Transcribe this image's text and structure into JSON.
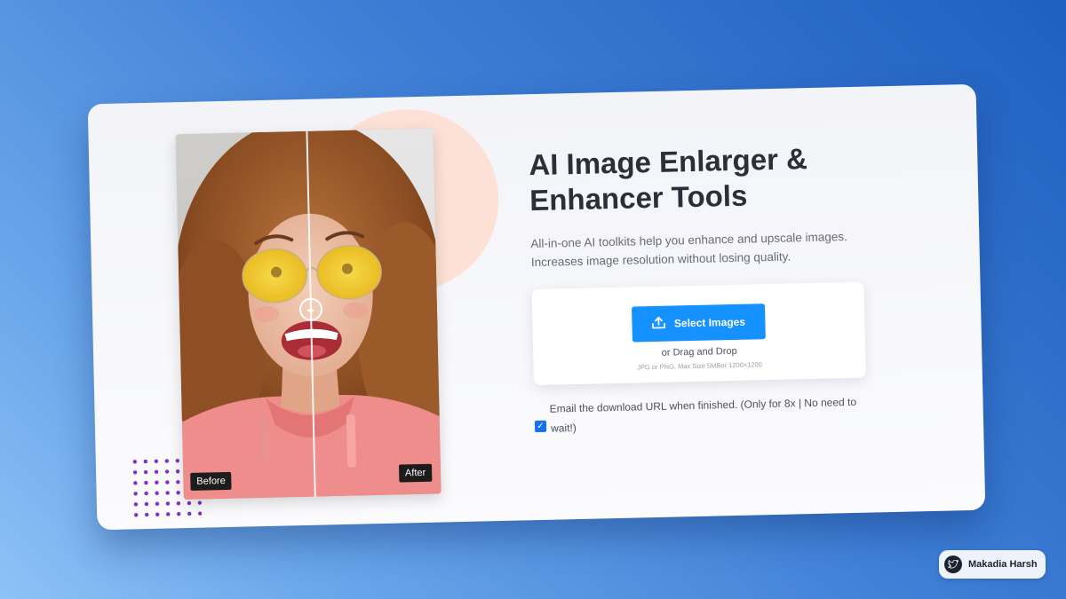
{
  "hero": {
    "title_line1": "AI Image Enlarger &",
    "title_line2": "Enhancer Tools",
    "subtitle_line1": "All-in-one AI toolkits help you enhance and upscale images.",
    "subtitle_line2": "Increases image resolution without losing quality."
  },
  "comparison": {
    "before_label": "Before",
    "after_label": "After",
    "handle_glyph": "◂▸",
    "split_position": 0.51
  },
  "upload": {
    "button_label": "Select Images",
    "button_icon": "upload-icon",
    "drag_text": "or Drag and Drop",
    "hint_text": "JPG or PNG. Max Size 5MBor 1200×1200"
  },
  "email_option": {
    "label_line1": "Email the download URL when finished. (Only for 8x | No need to",
    "label_line2": "wait!)",
    "checked": true
  },
  "credit": {
    "name": "Makadia Harsh",
    "icon": "twitter-bird-icon"
  },
  "colors": {
    "background_start": "#1f5fbf",
    "background_end": "#8dc2f6",
    "accent_button": "#1592ff",
    "blob": "#fde1d6",
    "dots": "#7b2fc7",
    "title": "#2b2f38"
  }
}
